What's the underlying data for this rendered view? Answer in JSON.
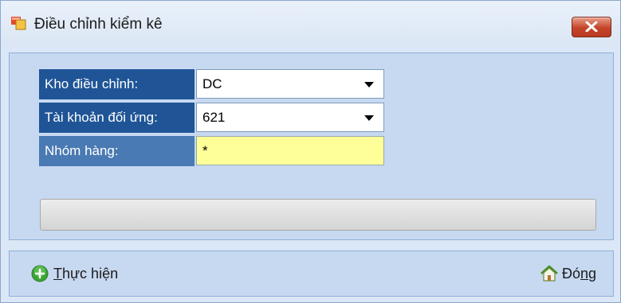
{
  "window": {
    "title": "Điều chỉnh kiểm kê"
  },
  "form": {
    "kho_label": "Kho điều chỉnh:",
    "kho_value": "DC",
    "tk_label": "Tài khoản đối ứng:",
    "tk_value": "621",
    "nhom_label": "Nhóm hàng:",
    "nhom_value": "*"
  },
  "progress": {
    "value_percent": 0
  },
  "footer": {
    "execute": {
      "first": "T",
      "rest": "hực hiện"
    },
    "close": {
      "start": "Đó",
      "under": "n",
      "end": "g"
    }
  },
  "icons": {
    "app": "window-form-icon",
    "close": "close-x-icon",
    "execute": "green-plus-circle-icon",
    "home": "home-icon"
  },
  "colors": {
    "label_dark": "#1f5597",
    "label_light": "#4a7ab3",
    "highlight_input": "#ffff99",
    "panel": "#c7d9f1"
  }
}
